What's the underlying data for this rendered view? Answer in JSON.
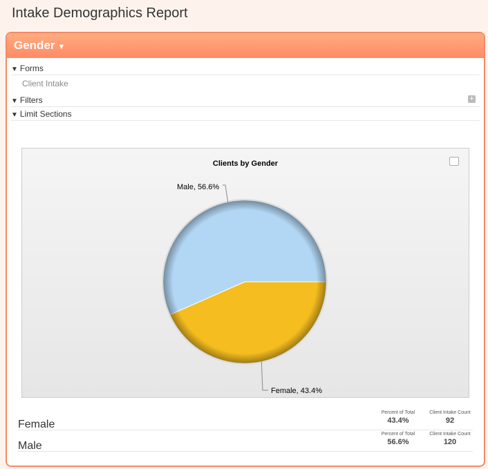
{
  "page": {
    "title": "Intake Demographics Report"
  },
  "panel": {
    "title": "Gender",
    "accent": "#ff8a66",
    "sections": [
      {
        "label": "Forms",
        "items": [
          "Client Intake"
        ]
      },
      {
        "label": "Filters"
      },
      {
        "label": "Limit Sections"
      }
    ]
  },
  "chart_data": {
    "type": "pie",
    "title": "Clients by Gender",
    "slices": [
      {
        "label": "Female",
        "value": 43.4,
        "color": "#f5bd1f",
        "data_label": "Female, 43.4%"
      },
      {
        "label": "Male",
        "value": 56.6,
        "color": "#b2d7f5",
        "data_label": "Male, 56.6%"
      }
    ]
  },
  "table": {
    "rows": [
      {
        "name": "Female",
        "percent_header": "Percent of Total",
        "percent": "43.4%",
        "count_header": "Client Intake Count",
        "count": "92"
      },
      {
        "name": "Male",
        "percent_header": "Percent of Total",
        "percent": "56.6%",
        "count_header": "Client Intake Count",
        "count": "120"
      }
    ]
  }
}
